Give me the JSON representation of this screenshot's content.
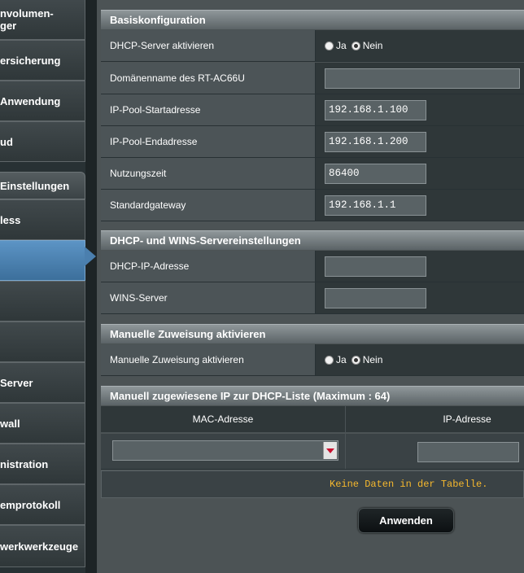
{
  "sidebar": {
    "items": [
      {
        "label": "nvolumen-\nger"
      },
      {
        "label": "ersicherung"
      },
      {
        "label": " Anwendung"
      },
      {
        "label": "ud"
      }
    ],
    "header": " Einstellungen",
    "items2": [
      {
        "label": "less"
      },
      {
        "label": ""
      },
      {
        "label": ""
      },
      {
        "label": ""
      },
      {
        "label": " Server"
      },
      {
        "label": "wall"
      },
      {
        "label": "nistration"
      },
      {
        "label": "emprotokoll"
      },
      {
        "label": "werkwerkzeuge"
      }
    ]
  },
  "basic": {
    "title": "Basiskonfiguration",
    "dhcp_enable": {
      "label": "DHCP-Server aktivieren",
      "yes": "Ja",
      "no": "Nein",
      "selected": "no"
    },
    "domain": {
      "label": "Domänenname des RT-AC66U",
      "value": ""
    },
    "pool_start": {
      "label": "IP-Pool-Startadresse",
      "value": "192.168.1.100"
    },
    "pool_end": {
      "label": "IP-Pool-Endadresse",
      "value": "192.168.1.200"
    },
    "lease": {
      "label": "Nutzungszeit",
      "value": "86400"
    },
    "gateway": {
      "label": "Standardgateway",
      "value": "192.168.1.1"
    }
  },
  "wins": {
    "title": "DHCP- und WINS-Servereinstellungen",
    "dns": {
      "label": "DHCP-IP-Adresse",
      "value": ""
    },
    "wins_server": {
      "label": "WINS-Server",
      "value": ""
    }
  },
  "manual": {
    "title": "Manuelle Zuweisung aktivieren",
    "enable": {
      "label": "Manuelle Zuweisung aktivieren",
      "yes": "Ja",
      "no": "Nein",
      "selected": "no"
    }
  },
  "list": {
    "title": "Manuell zugewiesene IP zur DHCP-Liste (Maximum : 64)",
    "col_mac": "MAC-Adresse",
    "col_ip": "IP-Adresse",
    "empty": "Keine Daten in der Tabelle."
  },
  "apply_label": "Anwenden"
}
